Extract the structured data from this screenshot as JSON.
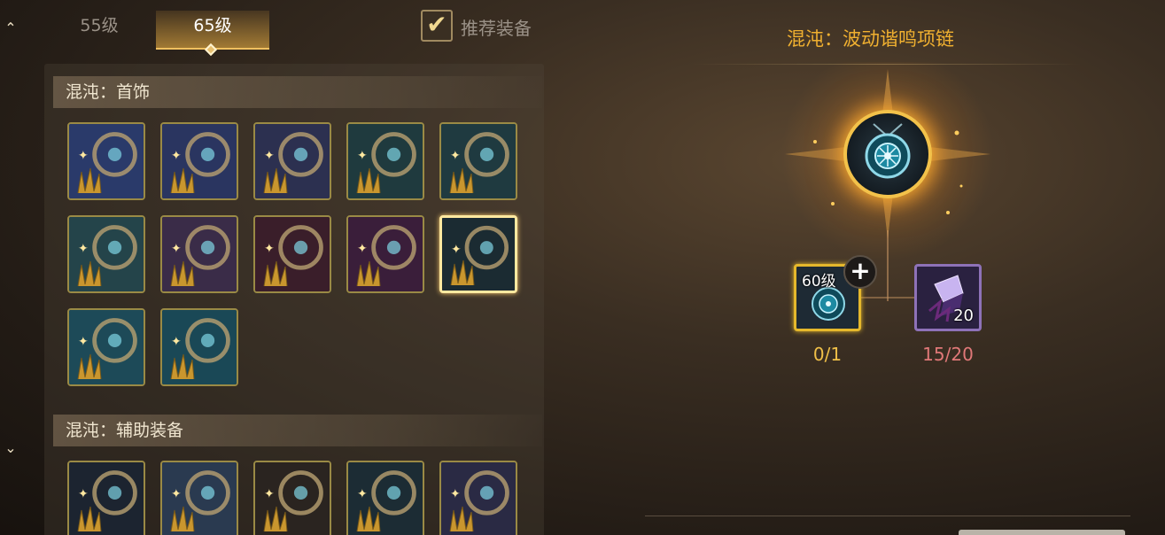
{
  "tabs": [
    {
      "label": "55级",
      "active": false
    },
    {
      "label": "65级",
      "active": true
    }
  ],
  "recommend": {
    "label": "推荐装备",
    "checked": true
  },
  "sections": {
    "jewelry": {
      "title": "混沌：首饰"
    },
    "support": {
      "title": "混沌：辅助装备"
    }
  },
  "items": {
    "jewelry": [
      {
        "icon": "music-necklace-icon",
        "color": "#2a3a6a"
      },
      {
        "icon": "music-note-bracelet-icon",
        "color": "#2a3560"
      },
      {
        "icon": "music-ring-icon",
        "color": "#2c3050"
      },
      {
        "icon": "gem-pendant-icon",
        "color": "#1f3a3e"
      },
      {
        "icon": "wing-bracelet-icon",
        "color": "#1f3a40"
      },
      {
        "icon": "blue-gem-ring-icon",
        "color": "#24444a"
      },
      {
        "icon": "gold-bracelet-icon",
        "color": "#3a2c48"
      },
      {
        "icon": "ruby-ring-icon",
        "color": "#3a1e2a"
      },
      {
        "icon": "ruby-earring-icon",
        "color": "#3a1e3a"
      },
      {
        "icon": "crystal-necklace-icon",
        "color": "#1b2b32",
        "selected": true
      },
      {
        "icon": "cyan-bracelet-icon",
        "color": "#1d4a58"
      },
      {
        "icon": "cyan-ring-icon",
        "color": "#1a4856"
      }
    ],
    "support": [
      {
        "icon": "dark-cloak-icon",
        "color": "#1c2430"
      },
      {
        "icon": "magic-tome-icon",
        "color": "#2a3a50"
      },
      {
        "icon": "chalice-icon",
        "color": "#2a2420"
      },
      {
        "icon": "clawed-gauntlet-icon",
        "color": "#1c2c34"
      },
      {
        "icon": "spirit-mask-icon",
        "color": "#2a2a44"
      }
    ]
  },
  "selected": {
    "title": "混沌：波动谐鸣项链",
    "icon": "crystal-necklace-icon"
  },
  "materials": [
    {
      "icon": "crystal-necklace-icon",
      "level": "60级",
      "count": "0/1"
    },
    {
      "icon": "purple-crystal-icon",
      "qty": "20",
      "count": "15/20"
    }
  ],
  "colors": {
    "gold": "#f0b030",
    "insufficient": "#e07878"
  }
}
